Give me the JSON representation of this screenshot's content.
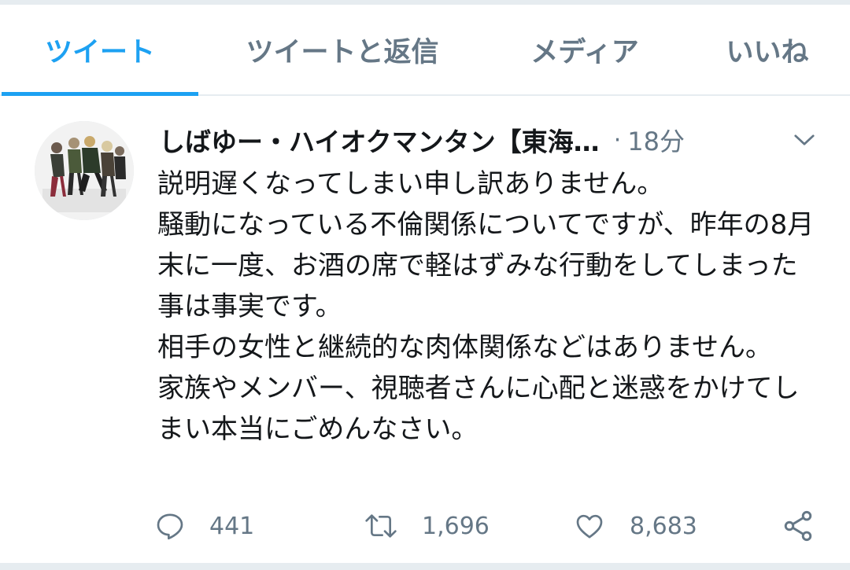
{
  "tabs": [
    {
      "label": "ツイート",
      "active": true
    },
    {
      "label": "ツイートと返信",
      "active": false
    },
    {
      "label": "メディア",
      "active": false
    },
    {
      "label": "いいね",
      "active": false
    }
  ],
  "tweet": {
    "author_name": "しばゆー・ハイオクマンタン【東海…",
    "separator": "·",
    "time": "18分",
    "text": "説明遅くなってしまい申し訳ありません。\n騒動になっている不倫関係についてですが、昨年の8月末に一度、お酒の席で軽はずみな行動をしてしまった事は事実です。\n相手の女性と継続的な肉体関係などはありません。\n家族やメンバー、視聴者さんに心配と迷惑をかけてしまい本当にごめんなさい。",
    "actions": {
      "reply_count": "441",
      "retweet_count": "1,696",
      "like_count": "8,683"
    }
  },
  "colors": {
    "accent": "#1da1f2",
    "secondary_text": "#657786",
    "primary_text": "#14171a",
    "divider": "#e6ecf0"
  },
  "icons": [
    "chevron-down-icon",
    "reply-icon",
    "retweet-icon",
    "like-icon",
    "share-icon"
  ]
}
